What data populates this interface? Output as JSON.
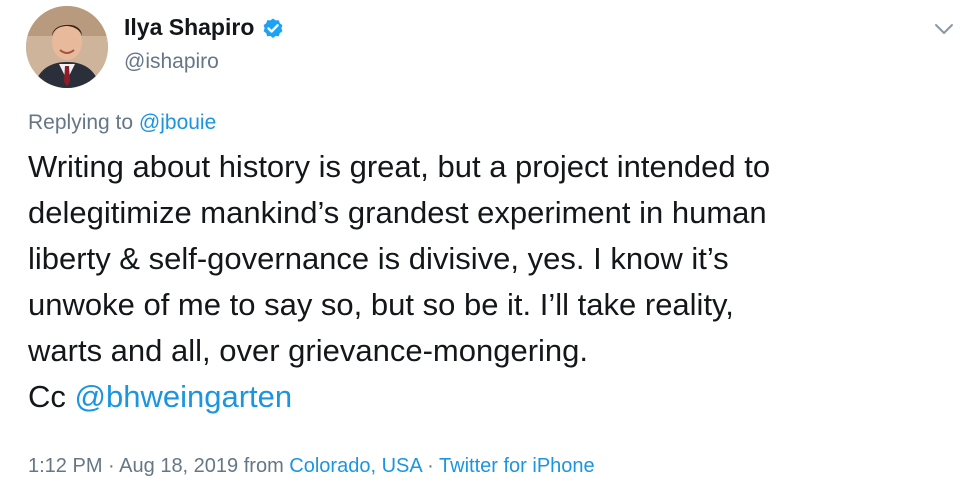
{
  "author": {
    "display_name": "Ilya Shapiro",
    "handle": "@ishapiro",
    "verified": true,
    "avatar_icon": "profile-photo"
  },
  "menu": {
    "icon": "chevron-down-icon"
  },
  "reply": {
    "prefix": "Replying to",
    "mention": "@jbouie"
  },
  "tweet": {
    "lines": [
      "Writing about history is great, but a project intended to",
      "delegitimize mankind’s grandest experiment in human",
      "liberty & self-governance is divisive, yes. I know it’s",
      "unwoke of me to say so, but so be it. I’ll take reality,",
      "warts and all, over grievance-mongering."
    ],
    "cc_prefix": "Cc",
    "cc_mention": "@bhweingarten"
  },
  "meta": {
    "time": "1:12 PM",
    "separator": "·",
    "date": "Aug 18, 2019",
    "from": "from",
    "location": "Colorado, USA",
    "source": "Twitter for iPhone"
  },
  "colors": {
    "text": "#14171a",
    "muted": "#657786",
    "link": "#1b95e0",
    "verified": "#1da1f2"
  }
}
